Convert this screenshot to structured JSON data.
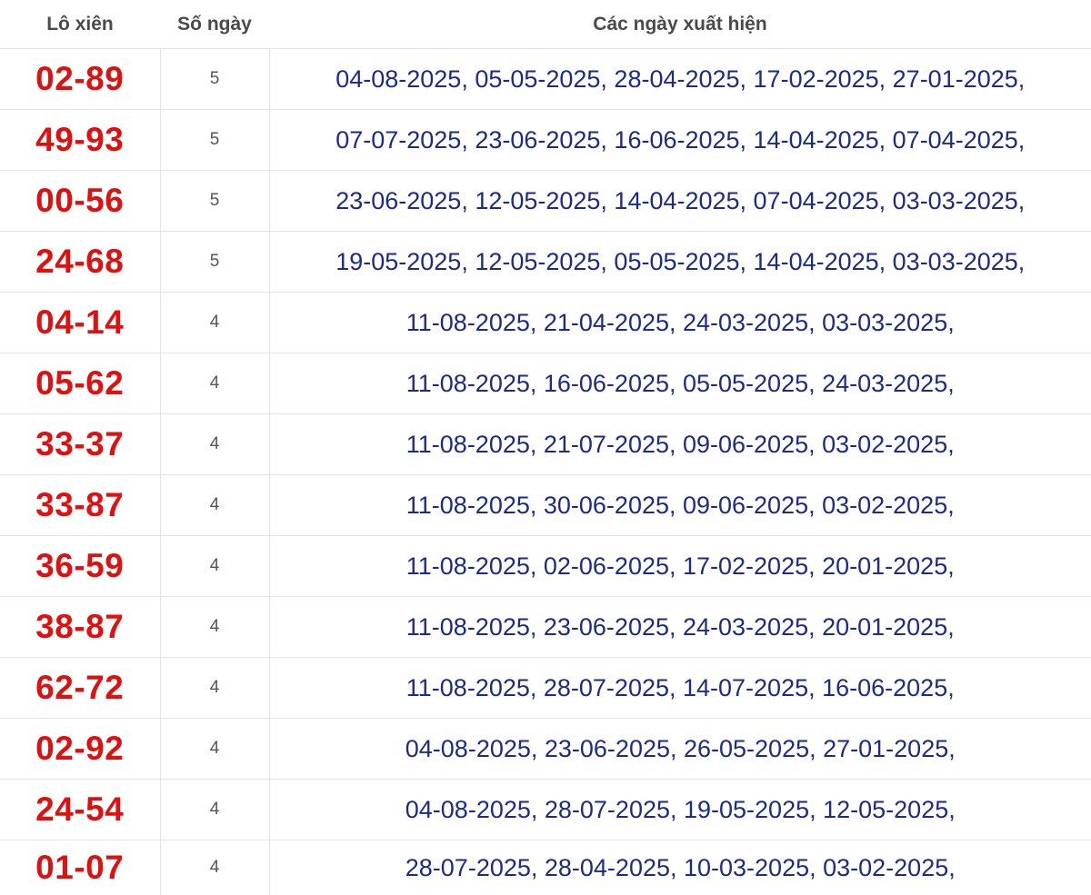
{
  "table": {
    "headers": {
      "pair": "Lô xiên",
      "days": "Số ngày",
      "dates": "Các ngày xuất hiện"
    },
    "rows": [
      {
        "pair": "02-89",
        "days": "5",
        "dates": "04-08-2025, 05-05-2025, 28-04-2025, 17-02-2025, 27-01-2025,"
      },
      {
        "pair": "49-93",
        "days": "5",
        "dates": "07-07-2025, 23-06-2025, 16-06-2025, 14-04-2025, 07-04-2025,"
      },
      {
        "pair": "00-56",
        "days": "5",
        "dates": "23-06-2025, 12-05-2025, 14-04-2025, 07-04-2025, 03-03-2025,"
      },
      {
        "pair": "24-68",
        "days": "5",
        "dates": "19-05-2025, 12-05-2025, 05-05-2025, 14-04-2025, 03-03-2025,"
      },
      {
        "pair": "04-14",
        "days": "4",
        "dates": "11-08-2025, 21-04-2025, 24-03-2025, 03-03-2025,"
      },
      {
        "pair": "05-62",
        "days": "4",
        "dates": "11-08-2025, 16-06-2025, 05-05-2025, 24-03-2025,"
      },
      {
        "pair": "33-37",
        "days": "4",
        "dates": "11-08-2025, 21-07-2025, 09-06-2025, 03-02-2025,"
      },
      {
        "pair": "33-87",
        "days": "4",
        "dates": "11-08-2025, 30-06-2025, 09-06-2025, 03-02-2025,"
      },
      {
        "pair": "36-59",
        "days": "4",
        "dates": "11-08-2025, 02-06-2025, 17-02-2025, 20-01-2025,"
      },
      {
        "pair": "38-87",
        "days": "4",
        "dates": "11-08-2025, 23-06-2025, 24-03-2025, 20-01-2025,"
      },
      {
        "pair": "62-72",
        "days": "4",
        "dates": "11-08-2025, 28-07-2025, 14-07-2025, 16-06-2025,"
      },
      {
        "pair": "02-92",
        "days": "4",
        "dates": "04-08-2025, 23-06-2025, 26-05-2025, 27-01-2025,"
      },
      {
        "pair": "24-54",
        "days": "4",
        "dates": "04-08-2025, 28-07-2025, 19-05-2025, 12-05-2025,"
      },
      {
        "pair": "01-07",
        "days": "4",
        "dates": "28-07-2025, 28-04-2025, 10-03-2025, 03-02-2025,"
      }
    ]
  }
}
